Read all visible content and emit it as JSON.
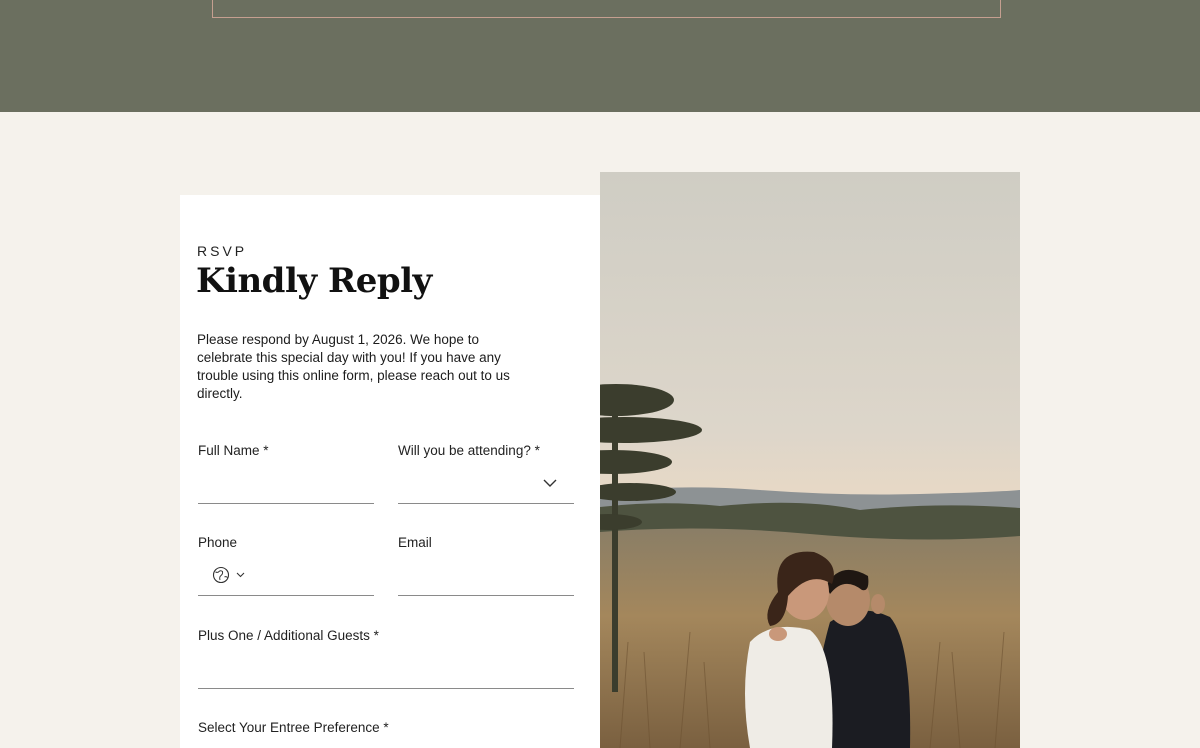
{
  "rsvp": {
    "eyebrow": "RSVP",
    "title": "Kindly Reply",
    "intro": "Please respond by August 1, 2026. We hope to celebrate this special day with you! If you have any trouble using this online form, please reach out to us directly."
  },
  "form": {
    "full_name": {
      "label": "Full Name *",
      "value": ""
    },
    "attending": {
      "label": "Will you be attending? *",
      "value": ""
    },
    "phone": {
      "label": "Phone",
      "value": "",
      "country_icon": "globe-icon"
    },
    "email": {
      "label": "Email",
      "value": ""
    },
    "guests": {
      "label": "Plus One / Additional Guests *",
      "value": ""
    },
    "entree": {
      "label": "Select Your Entree Preference *"
    }
  },
  "colors": {
    "top_band": "#6b6f5f",
    "page_bg": "#f5f2ec",
    "frame_border": "#c59f90",
    "card_bg": "#ffffff"
  },
  "photo": {
    "subject": "couple embracing in tall grass field at sunset"
  }
}
